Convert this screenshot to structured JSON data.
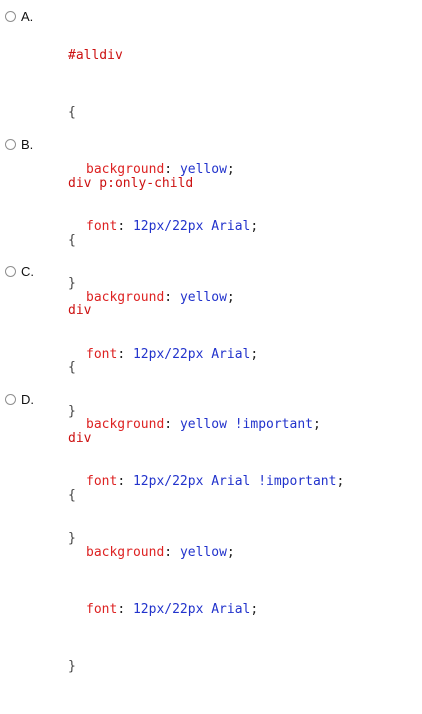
{
  "options": [
    {
      "letter": "A.",
      "selector": "#alldiv",
      "open_brace": "{",
      "close_brace": "}",
      "declarations": [
        {
          "prop": "background",
          "value": "yellow"
        },
        {
          "prop": "font",
          "value": "12px/22px Arial"
        }
      ]
    },
    {
      "letter": "B.",
      "selector": "div p:only-child",
      "open_brace": "{",
      "close_brace": "}",
      "declarations": [
        {
          "prop": "background",
          "value": "yellow"
        },
        {
          "prop": "font",
          "value": "12px/22px Arial"
        }
      ]
    },
    {
      "letter": "C.",
      "selector": "div",
      "open_brace": "{",
      "close_brace": "}",
      "declarations": [
        {
          "prop": "background",
          "value": "yellow !important"
        },
        {
          "prop": "font",
          "value": "12px/22px Arial !important"
        }
      ]
    },
    {
      "letter": "D.",
      "selector": "div",
      "open_brace": "{",
      "close_brace": "}",
      "declarations": [
        {
          "prop": "background",
          "value": "yellow"
        },
        {
          "prop": "font",
          "value": "12px/22px Arial"
        }
      ]
    }
  ],
  "syntax": {
    "colon": ":",
    "semicolon": ";"
  },
  "colors": {
    "selector": "#cc1111",
    "property": "#dd2222",
    "value": "#2233cc"
  }
}
